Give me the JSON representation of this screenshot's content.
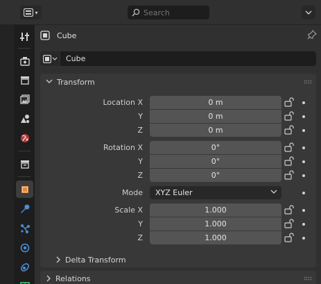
{
  "header": {
    "search_placeholder": "Search",
    "editor_type_icon": "properties-editor-icon",
    "options_icon": "chevron-down-icon"
  },
  "tabs": [
    {
      "name": "tool",
      "icon": "tool-icon",
      "active": false
    },
    {
      "name": "render",
      "icon": "render-icon",
      "active": false
    },
    {
      "name": "output",
      "icon": "output-icon",
      "active": false
    },
    {
      "name": "view-layer",
      "icon": "view-layer-icon",
      "active": false
    },
    {
      "name": "scene",
      "icon": "scene-icon",
      "active": false
    },
    {
      "name": "world",
      "icon": "world-icon",
      "active": false
    },
    {
      "name": "collection",
      "icon": "collection-icon",
      "active": false
    },
    {
      "name": "object",
      "icon": "object-icon",
      "active": true
    },
    {
      "name": "modifiers",
      "icon": "wrench-icon",
      "active": false
    },
    {
      "name": "particles",
      "icon": "particles-icon",
      "active": false
    },
    {
      "name": "physics",
      "icon": "physics-icon",
      "active": false
    },
    {
      "name": "constraints",
      "icon": "constraints-icon",
      "active": false
    },
    {
      "name": "data",
      "icon": "mesh-data-icon",
      "active": false
    }
  ],
  "context": {
    "object_name": "Cube"
  },
  "datablock": {
    "name": "Cube"
  },
  "transform": {
    "title": "Transform",
    "location_label": "Location X",
    "y_label": "Y",
    "z_label": "Z",
    "location": [
      "0 m",
      "0 m",
      "0 m"
    ],
    "rotation_label": "Rotation X",
    "rotation": [
      "0°",
      "0°",
      "0°"
    ],
    "mode_label": "Mode",
    "mode_value": "XYZ Euler",
    "scale_label": "Scale X",
    "scale": [
      "1.000",
      "1.000",
      "1.000"
    ]
  },
  "delta_transform": {
    "title": "Delta Transform"
  },
  "relations": {
    "title": "Relations"
  },
  "colors": {
    "accent_orange": "#e0863a",
    "accent_blue": "#4b8fd6"
  }
}
